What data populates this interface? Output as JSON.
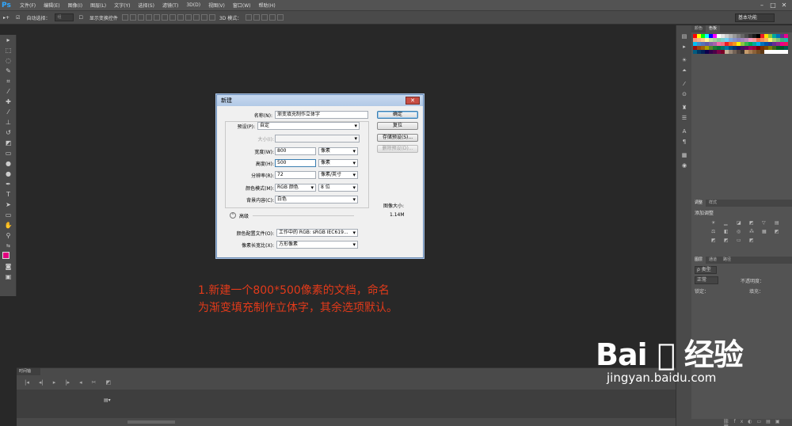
{
  "menubar": {
    "logo": "Ps",
    "items": [
      "文件(F)",
      "编辑(E)",
      "图像(I)",
      "图层(L)",
      "文字(Y)",
      "选择(S)",
      "滤镜(T)",
      "3D(D)",
      "视图(V)",
      "窗口(W)",
      "帮助(H)"
    ]
  },
  "options": {
    "auto_select": "自动选择：",
    "layer_select": "组",
    "show_transform": "显示变换控件",
    "mode3d": "3D 模式：",
    "workspace": "基本功能"
  },
  "timeline": {
    "tab": "时间轴"
  },
  "panels": {
    "color_tabs": [
      "颜色",
      "色板"
    ],
    "adjust_tabs": [
      "调整",
      "样式"
    ],
    "adjust_title": "添加调整",
    "layer_tabs": [
      "图层",
      "通道",
      "路径"
    ],
    "layer_kind": "ρ 类型",
    "blend": "正常",
    "opacity": "不透明度：",
    "lock": "锁定：",
    "fill": "填充："
  },
  "dialog": {
    "title": "新建",
    "close": "✕",
    "name_label": "名称(N):",
    "name_value": "渐变填充制作立体字",
    "preset_label": "预设(P):",
    "preset_value": "自定",
    "size_label": "大小(I):",
    "size_value": "",
    "width_label": "宽度(W):",
    "width_value": "800",
    "width_unit": "像素",
    "height_label": "高度(H):",
    "height_value": "500",
    "height_unit": "像素",
    "res_label": "分辨率(R):",
    "res_value": "72",
    "res_unit": "像素/英寸",
    "color_label": "颜色模式(M):",
    "color_value": "RGB 颜色",
    "bits_value": "8 位",
    "bg_label": "背景内容(C):",
    "bg_value": "白色",
    "advanced": "高级",
    "profile_label": "颜色配置文件(O):",
    "profile_value": "工作中的 RGB: sRGB IEC619...",
    "aspect_label": "像素长宽比(X):",
    "aspect_value": "方形像素",
    "ok": "确定",
    "reset": "复位",
    "save_preset": "存储预设(S)...",
    "delete_preset": "删除预设(D)...",
    "image_size_label": "图像大小:",
    "image_size_value": "1.14M"
  },
  "caption": {
    "line1": "1.新建一个800*500像素的文档，命名",
    "line2": "为渐变填充制作立体字，其余选项默认。"
  },
  "watermark": {
    "main": "Bai ⃝ 经验",
    "sub": "jingyan.baidu.com"
  }
}
